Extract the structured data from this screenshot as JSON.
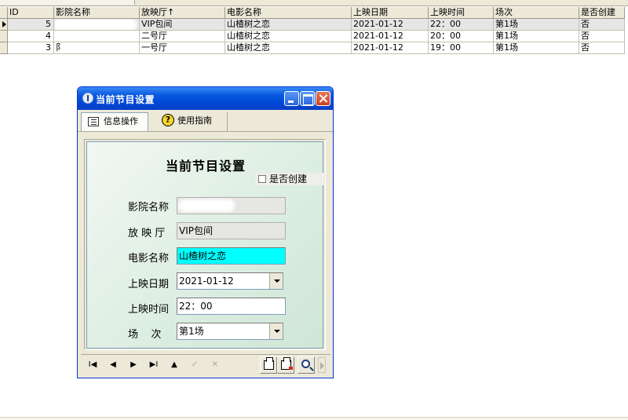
{
  "grid": {
    "headers": [
      "ID",
      "影院名称",
      "放映厅↑",
      "电影名称",
      "上映日期",
      "上映时间",
      "场次",
      "是否创建"
    ],
    "rows": [
      {
        "id": "5",
        "cinema": "",
        "hall": "VIP包间",
        "movie": "山楂树之恋",
        "date": "2021-01-12",
        "time": "22：00",
        "session": "第1场",
        "created": "否"
      },
      {
        "id": "4",
        "cinema": "",
        "hall": "二号厅",
        "movie": "山楂树之恋",
        "date": "2021-01-12",
        "time": "20：00",
        "session": "第1场",
        "created": "否"
      },
      {
        "id": "3",
        "cinema": "阝",
        "hall": "一号厅",
        "movie": "山楂树之恋",
        "date": "2021-01-12",
        "time": "19：00",
        "session": "第1场",
        "created": "否"
      }
    ]
  },
  "window": {
    "title": "当前节目设置",
    "tabs": [
      {
        "label": "信息操作",
        "icon": "list-icon"
      },
      {
        "label": "使用指南",
        "icon": "help-icon"
      }
    ],
    "form": {
      "title": "当前节目设置",
      "created_checkbox_label": "是否创建",
      "created_checked": false,
      "fields": {
        "cinema": {
          "label": "影院名称",
          "value": ""
        },
        "hall": {
          "label": "放 映 厅",
          "value": "VIP包间"
        },
        "movie": {
          "label": "电影名称",
          "value": "山楂树之恋"
        },
        "date": {
          "label": "上映日期",
          "value": "2021-01-12"
        },
        "time": {
          "label": "上映时间",
          "value": "22：00"
        },
        "session": {
          "label": "场    次",
          "value": "第1场"
        }
      }
    },
    "navigator": {
      "first": "I◀",
      "prior": "◀",
      "next": "▶",
      "last": "▶I",
      "insert": "▲",
      "post": "✓",
      "cancel": "✕"
    }
  },
  "colors": {
    "titlebar": "#0859e0",
    "highlight_field": "#00ffff",
    "form_background": "#ddeee2"
  }
}
